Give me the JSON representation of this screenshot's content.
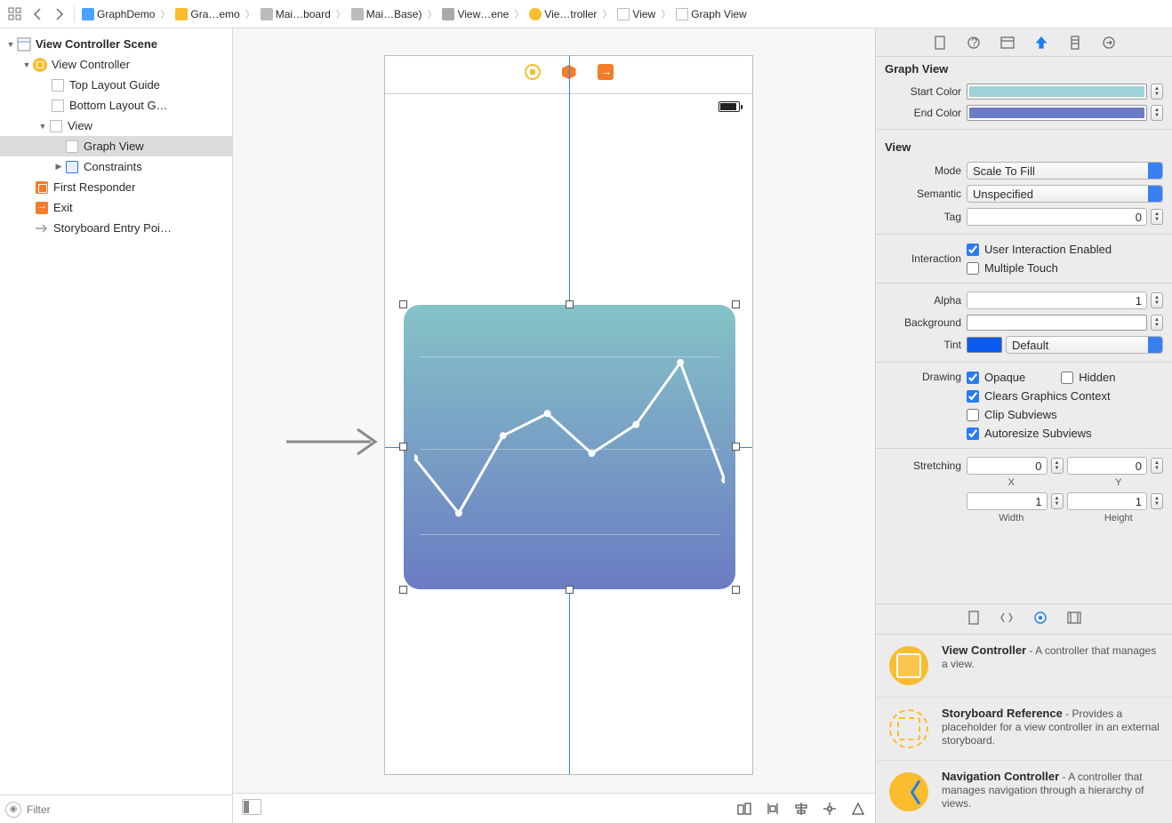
{
  "breadcrumb": {
    "items": [
      {
        "label": "GraphDemo",
        "type": "proj"
      },
      {
        "label": "Gra…emo",
        "type": "folder"
      },
      {
        "label": "Mai…board",
        "type": "sb"
      },
      {
        "label": "Mai…Base)",
        "type": "sb"
      },
      {
        "label": "View…ene",
        "type": "scene"
      },
      {
        "label": "Vie…troller",
        "type": "vc"
      },
      {
        "label": "View",
        "type": "view"
      },
      {
        "label": "Graph View",
        "type": "view"
      }
    ]
  },
  "outline": {
    "scene_title": "View Controller Scene",
    "items": [
      {
        "label": "View Controller"
      },
      {
        "label": "Top Layout Guide"
      },
      {
        "label": "Bottom Layout G…"
      },
      {
        "label": "View"
      },
      {
        "label": "Graph View"
      },
      {
        "label": "Constraints"
      },
      {
        "label": "First Responder"
      },
      {
        "label": "Exit"
      },
      {
        "label": "Storyboard Entry Poi…"
      }
    ],
    "filter_placeholder": "Filter"
  },
  "inspector": {
    "graphview": {
      "title": "Graph View",
      "start_label": "Start Color",
      "end_label": "End Color",
      "start_color": "#9dd2d6",
      "end_color": "#6b7cc3"
    },
    "view": {
      "title": "View",
      "mode_label": "Mode",
      "mode_value": "Scale To Fill",
      "semantic_label": "Semantic",
      "semantic_value": "Unspecified",
      "tag_label": "Tag",
      "tag_value": "0",
      "interaction_label": "Interaction",
      "user_interaction": "User Interaction Enabled",
      "multiple_touch": "Multiple Touch",
      "alpha_label": "Alpha",
      "alpha_value": "1",
      "background_label": "Background",
      "background_color": "#ffffff",
      "tint_label": "Tint",
      "tint_value": "Default",
      "drawing_label": "Drawing",
      "opaque": "Opaque",
      "hidden": "Hidden",
      "clears": "Clears Graphics Context",
      "clip": "Clip Subviews",
      "autoresize": "Autoresize Subviews",
      "stretching_label": "Stretching",
      "stretch_x": "0",
      "stretch_y": "0",
      "x_lbl": "X",
      "y_lbl": "Y",
      "stretch_w": "1",
      "stretch_h": "1",
      "w_lbl": "Width",
      "h_lbl": "Height"
    }
  },
  "library": {
    "items": [
      {
        "title": "View Controller",
        "sep": " - ",
        "desc": "A controller that manages a view."
      },
      {
        "title": "Storyboard Reference",
        "sep": " - ",
        "desc": "Provides a placeholder for a view controller in an external storyboard."
      },
      {
        "title": "Navigation Controller",
        "sep": " - ",
        "desc": "A controller that manages navigation through a hierarchy of views."
      }
    ]
  },
  "chart_data": {
    "type": "line",
    "x": [
      0,
      1,
      2,
      3,
      4,
      5,
      6,
      7
    ],
    "values": [
      0.45,
      0.2,
      0.55,
      0.65,
      0.47,
      0.6,
      0.88,
      0.35
    ],
    "ylim": [
      0,
      1
    ],
    "gridlines": [
      0.2,
      0.5,
      0.8
    ],
    "start_color": "#85c3c7",
    "end_color": "#6b7cc3"
  }
}
